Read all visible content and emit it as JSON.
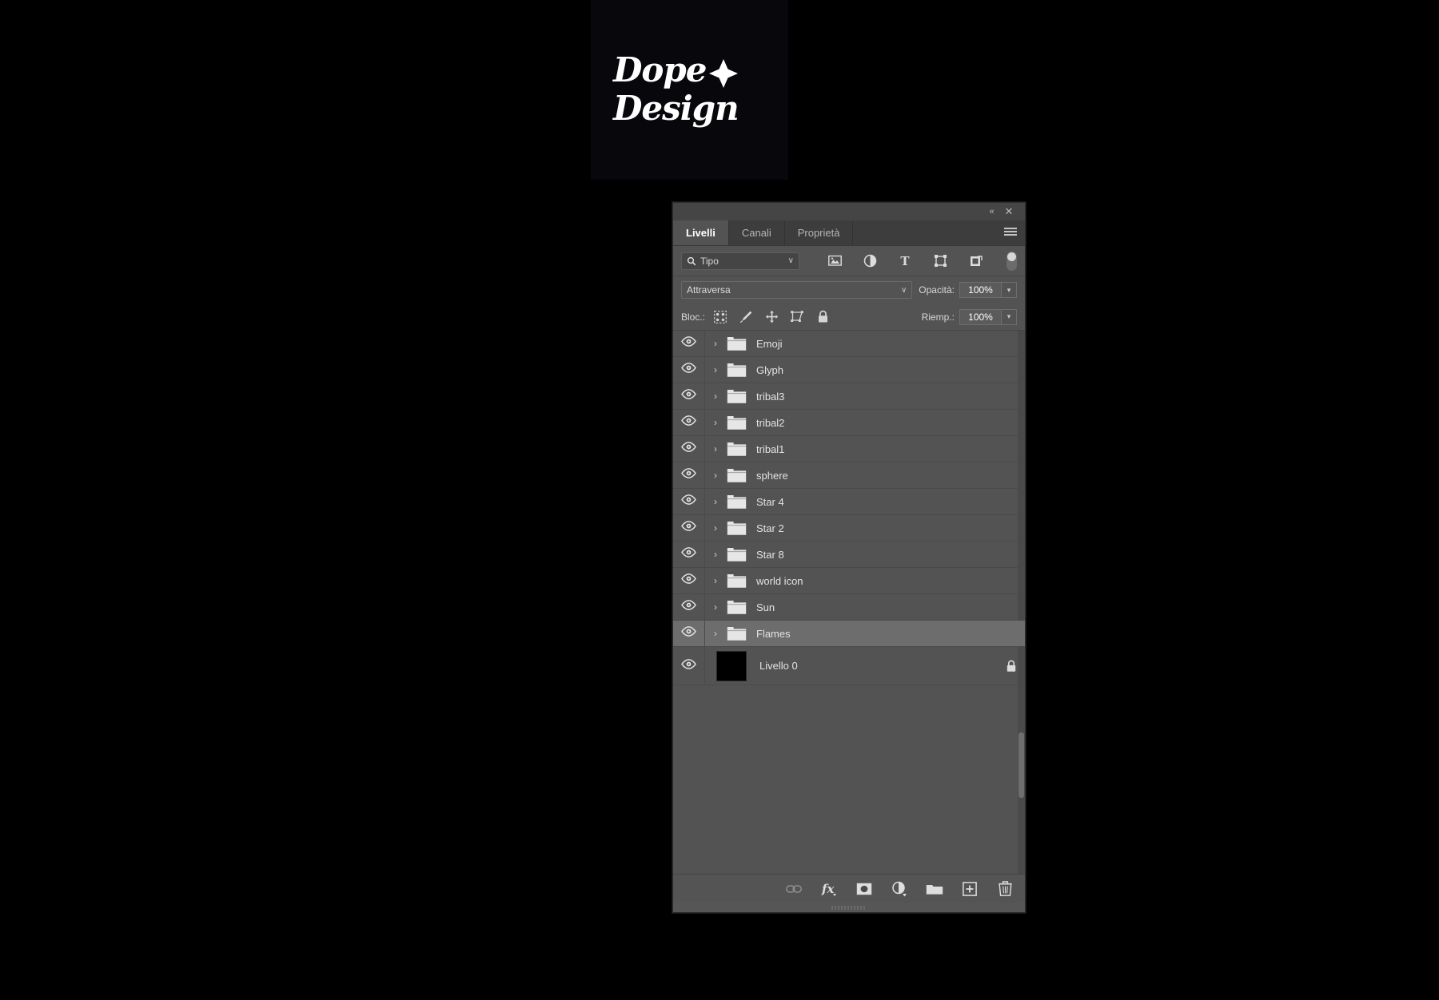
{
  "canvas": {
    "background_color": "#07070c",
    "logo": {
      "line1": "Dope",
      "line2": "Design",
      "star_icon": "four-point-star-icon",
      "text_color": "#ffffff"
    }
  },
  "panel": {
    "titlebar": {
      "collapse_label": "«",
      "close_label": "✕"
    },
    "tabs": [
      {
        "label": "Livelli",
        "active": true
      },
      {
        "label": "Canali",
        "active": false
      },
      {
        "label": "Proprietà",
        "active": false
      }
    ],
    "menu_icon": "hamburger-menu-icon",
    "filter": {
      "search_icon": "search-icon",
      "value": "Tipo",
      "chevron": "∨",
      "icons": [
        "pixel-layer-filter-icon",
        "adjustment-layer-filter-icon",
        "type-layer-filter-icon",
        "shape-layer-filter-icon",
        "smart-object-filter-icon"
      ],
      "toggle": "filter-enable-toggle"
    },
    "blend": {
      "mode": "Attraversa",
      "chevron": "∨",
      "opacity_label": "Opacità:",
      "opacity_value": "100%"
    },
    "lock": {
      "label": "Bloc.:",
      "icons": [
        "lock-transparent-pixels-icon",
        "lock-image-pixels-icon",
        "lock-position-icon",
        "lock-artboard-nesting-icon",
        "lock-all-icon"
      ],
      "fill_label": "Riemp.:",
      "fill_value": "100%"
    },
    "layers": [
      {
        "name": "Emoji",
        "type": "group",
        "visible": true,
        "selected": false,
        "locked": false
      },
      {
        "name": "Glyph",
        "type": "group",
        "visible": true,
        "selected": false,
        "locked": false
      },
      {
        "name": "tribal3",
        "type": "group",
        "visible": true,
        "selected": false,
        "locked": false
      },
      {
        "name": "tribal2",
        "type": "group",
        "visible": true,
        "selected": false,
        "locked": false
      },
      {
        "name": "tribal1",
        "type": "group",
        "visible": true,
        "selected": false,
        "locked": false
      },
      {
        "name": "sphere",
        "type": "group",
        "visible": true,
        "selected": false,
        "locked": false
      },
      {
        "name": "Star 4",
        "type": "group",
        "visible": true,
        "selected": false,
        "locked": false
      },
      {
        "name": "Star 2",
        "type": "group",
        "visible": true,
        "selected": false,
        "locked": false
      },
      {
        "name": "Star 8",
        "type": "group",
        "visible": true,
        "selected": false,
        "locked": false
      },
      {
        "name": "world icon",
        "type": "group",
        "visible": true,
        "selected": false,
        "locked": false
      },
      {
        "name": "Sun",
        "type": "group",
        "visible": true,
        "selected": false,
        "locked": false
      },
      {
        "name": "Flames",
        "type": "group",
        "visible": true,
        "selected": true,
        "locked": false
      },
      {
        "name": "Livello 0",
        "type": "pixel",
        "visible": true,
        "selected": false,
        "locked": true,
        "thumb_color": "#000000"
      }
    ],
    "footer_buttons": [
      "link-layers-icon",
      "layer-styles-fx-icon",
      "add-layer-mask-icon",
      "new-adjustment-layer-icon",
      "new-group-icon",
      "new-layer-icon",
      "delete-layer-icon"
    ],
    "colors": {
      "panel_bg": "#535353",
      "tab_bg": "#3d3d3d",
      "selected_row": "#6d6d6d",
      "text": "#e3e3e3"
    }
  }
}
